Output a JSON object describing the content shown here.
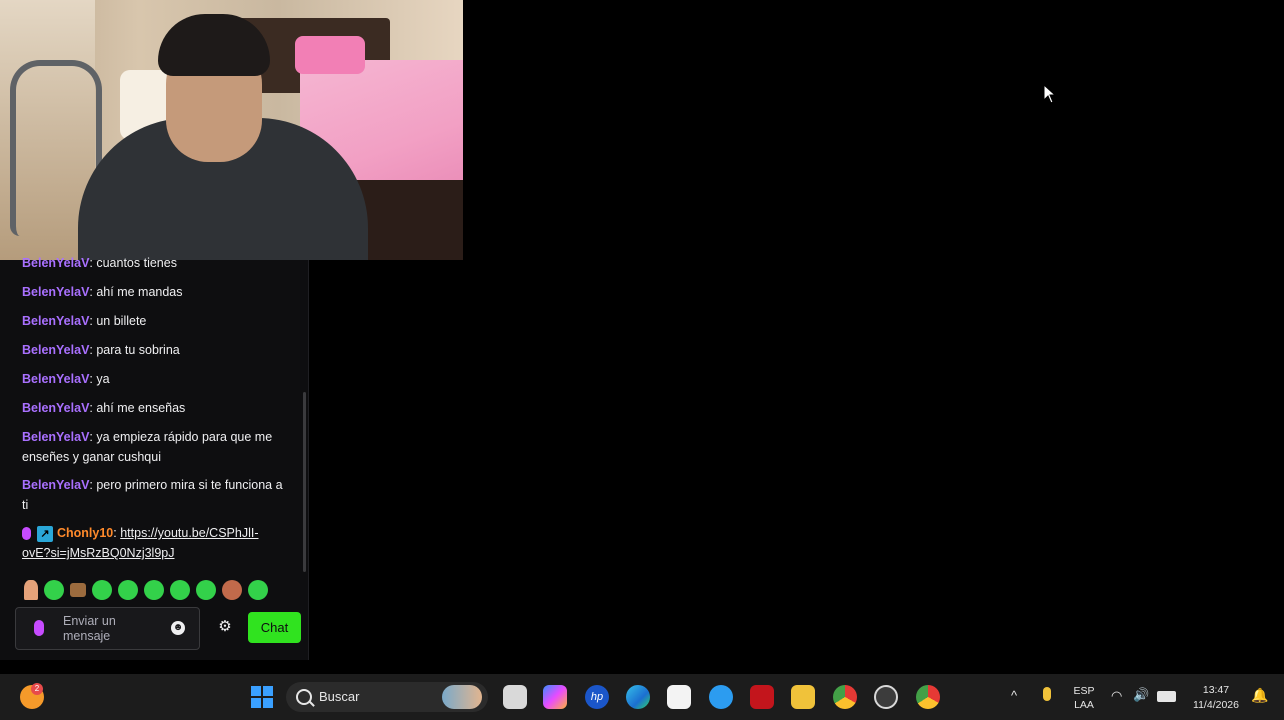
{
  "chat": {
    "messages": [
      {
        "user": "BelenYelaV",
        "text": ": cuantos tienes"
      },
      {
        "user": "BelenYelaV",
        "text": ": ahí me mandas"
      },
      {
        "user": "BelenYelaV",
        "text": ": un billete"
      },
      {
        "user": "BelenYelaV",
        "text": ": para tu sobrina"
      },
      {
        "user": "BelenYelaV",
        "text": ": ya"
      },
      {
        "user": "BelenYelaV",
        "text": ": ahí me enseñas"
      },
      {
        "user": "BelenYelaV",
        "text": ": ya empieza rápido para que me enseñes y ganar cushqui"
      },
      {
        "user": "BelenYelaV",
        "text": ": pero primero mira si te funciona a ti"
      }
    ],
    "link_message": {
      "user": "Chonly10",
      "separator": ": ",
      "link": "https://youtu.be/CSPhJlI-ovE?si=jMsRzBQ0Nzj3l9pJ"
    },
    "input_placeholder": "Enviar un mensaje",
    "send_label": "Chat",
    "colors": {
      "username": "#a970ff",
      "username_alt": "#ff8a2b",
      "send_button": "#30e31f"
    }
  },
  "taskbar": {
    "search_placeholder": "Buscar",
    "language": "ESP",
    "language_region": "LAA",
    "time": "13:47",
    "date": "11/4/2026",
    "notification_count": "2",
    "pinned_icons": [
      "files-icon",
      "copilot-icon",
      "hp-icon",
      "edge-icon",
      "store-icon",
      "weather-icon",
      "mcafee-icon",
      "explorer-icon",
      "chrome-icon",
      "obs-icon",
      "chrome-icon-2"
    ]
  }
}
